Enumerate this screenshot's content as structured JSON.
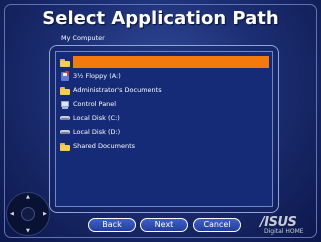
{
  "window": {
    "title": "Select Application Path"
  },
  "breadcrumb": "My Computer",
  "list": {
    "items": [
      {
        "label": "",
        "icon": "folder-icon",
        "selected": true
      },
      {
        "label": "3½ Floppy (A:)",
        "icon": "floppy-icon",
        "selected": false
      },
      {
        "label": "Administrator's Documents",
        "icon": "folder-icon",
        "selected": false
      },
      {
        "label": "Control Panel",
        "icon": "control-panel-icon",
        "selected": false
      },
      {
        "label": "Local Disk (C:)",
        "icon": "disk-icon",
        "selected": false
      },
      {
        "label": "Local Disk (D:)",
        "icon": "disk-icon",
        "selected": false
      },
      {
        "label": "Shared Documents",
        "icon": "folder-icon",
        "selected": false
      }
    ]
  },
  "buttons": {
    "back": "Back",
    "next": "Next",
    "cancel": "Cancel"
  },
  "brand": {
    "logo_text": "/ISUS",
    "product": "Digital HOME"
  },
  "colors": {
    "selection": "#f47a0d",
    "background": "#1c2e73",
    "accent": "#3f5fc9"
  }
}
